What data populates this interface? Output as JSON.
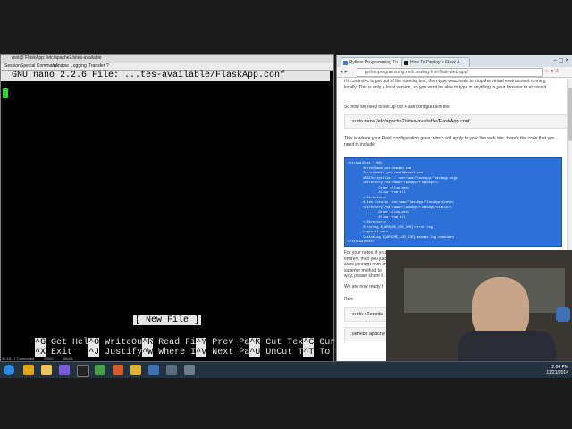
{
  "ssh_window": {
    "title": "root@ FlaskApp: /etc/apache2/sites-available",
    "menu": [
      "Session",
      "Special Command",
      "Window",
      "Logging",
      "Transfer",
      "?"
    ],
    "status_bar": [
      "00:18:17 Connected",
      "SSH2",
      "80x24"
    ]
  },
  "nano": {
    "header": "  GNU nano 2.2.6 File: ...tes-available/FlaskApp.conf",
    "status": "[ New File ]",
    "shortcuts_row1": [
      {
        "key": "^G",
        "label": "Get Hel"
      },
      {
        "key": "^O",
        "label": "WriteOu"
      },
      {
        "key": "^R",
        "label": "Read Fi"
      },
      {
        "key": "^Y",
        "label": "Prev Pa"
      },
      {
        "key": "^K",
        "label": "Cut Tex"
      },
      {
        "key": "^C",
        "label": "Cur Pos"
      }
    ],
    "shortcuts_row2": [
      {
        "key": "^X",
        "label": "Exit"
      },
      {
        "key": "^J",
        "label": "Justify"
      },
      {
        "key": "^W",
        "label": "Where I"
      },
      {
        "key": "^V",
        "label": "Next Pa"
      },
      {
        "key": "^U",
        "label": "UnCut T"
      },
      {
        "key": "^T",
        "label": "To Spell"
      }
    ]
  },
  "browser": {
    "tabs": [
      "Python Programming Tu",
      "How To Deploy a Flask A"
    ],
    "url": "pythonprogramming.net/creating-first-flask-web-app/",
    "paragraphs": {
      "p1": "Hit control+c to get out of the running text, then type deactivate to stop the virtual environment running locally. This is only a local version, so you wont be able to type in anything to your browser to access it.",
      "p2": "So now we need to set up our Flask configuration file:",
      "cmd1": "sudo nano /etc/apache2/sites-available/FlaskApp.conf",
      "p3": "This is where your Flask configuration goes, which will apply to your live web site. Here's the code that you need to include:",
      "p4": "For your notes, if you want to add more domains that point to the same Flask App, or a different app entirely, then you just copy and paste the above code and change the domain name. So, if you want www.yourapp.com and yourapp.com to both work, you will need two versions. There might be a superior method to",
      "p4b": "way, please share it",
      "p5": "We are now ready t",
      "p6": "Run:",
      "cmd2": "sudo a2ensite",
      "cmd3": "service apache"
    },
    "code_lines": [
      "<VirtualHost *:80>",
      "        ServerName yourdomain.com",
      "        ServerAdmin youremail@email.com",
      "        WSGIScriptAlias / /var/www/FlaskApp/flaskapp.wsgi",
      "        <Directory /var/www/FlaskApp/FlaskApp/>",
      "                Order allow,deny",
      "                Allow from all",
      "        </Directory>",
      "        Alias /static /var/www/FlaskApp/FlaskApp/static",
      "        <Directory /var/www/FlaskApp/FlaskApp/static/>",
      "                Order allow,deny",
      "                Allow from all",
      "        </Directory>",
      "        ErrorLog ${APACHE_LOG_DIR}/error.log",
      "        LogLevel warn",
      "        CustomLog ${APACHE_LOG_DIR}/access.log combined",
      "</VirtualHost>"
    ]
  },
  "taskbar": {
    "icons": [
      "start-icon",
      "chrome-icon",
      "folder-icon",
      "media-icon",
      "cmd-icon",
      "firefox-icon",
      "chrome-icon-2",
      "python-icon",
      "putty-icon",
      "window-icon"
    ],
    "clock_time": "2:04 PM",
    "clock_date": "11/21/2014"
  },
  "colors": {
    "code_bg": "#2c70d8",
    "terminal_bg": "#000000",
    "terminal_fg": "#e8e8e8",
    "cursor": "#2cd62c"
  }
}
